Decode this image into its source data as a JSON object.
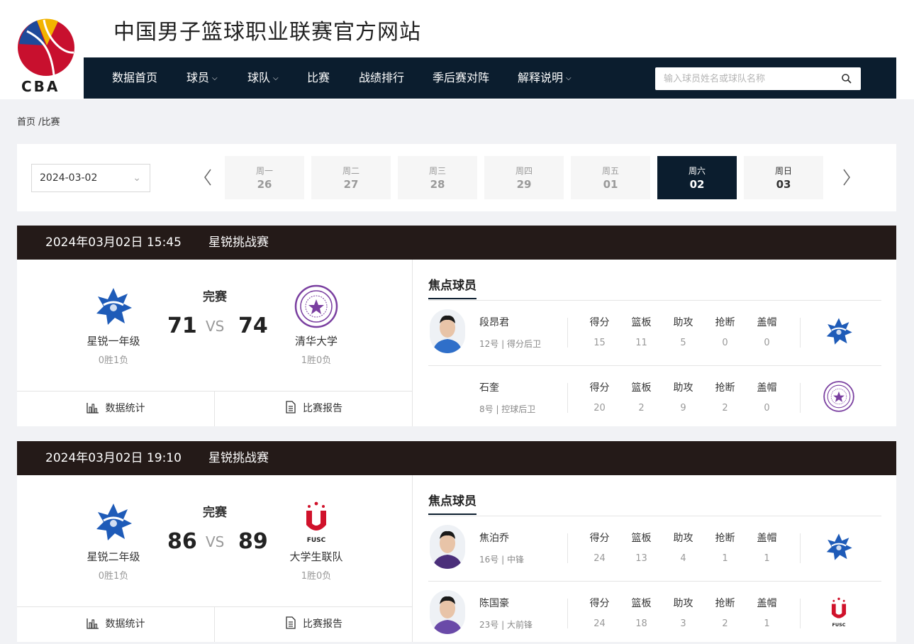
{
  "site": {
    "title": "中国男子篮球职业联赛官方网站",
    "logo_text": "CBA"
  },
  "nav": {
    "items": [
      {
        "label": "数据首页",
        "dropdown": false
      },
      {
        "label": "球员",
        "dropdown": true
      },
      {
        "label": "球队",
        "dropdown": true
      },
      {
        "label": "比赛",
        "dropdown": false
      },
      {
        "label": "战绩排行",
        "dropdown": false
      },
      {
        "label": "季后赛对阵",
        "dropdown": false
      },
      {
        "label": "解释说明",
        "dropdown": true
      }
    ],
    "search_placeholder": "输入球员姓名或球队名称"
  },
  "breadcrumb": {
    "home": "首页",
    "sep": " /",
    "current": "比赛"
  },
  "date_bar": {
    "selected_date": "2024-03-02",
    "days": [
      {
        "weekday": "周一",
        "day": "26"
      },
      {
        "weekday": "周二",
        "day": "27"
      },
      {
        "weekday": "周三",
        "day": "28"
      },
      {
        "weekday": "周四",
        "day": "29"
      },
      {
        "weekday": "周五",
        "day": "01"
      },
      {
        "weekday": "周六",
        "day": "02"
      },
      {
        "weekday": "周日",
        "day": "03"
      }
    ],
    "active_index": 5
  },
  "focus_label": "焦点球员",
  "stat_labels": [
    "得分",
    "篮板",
    "助攻",
    "抢断",
    "盖帽"
  ],
  "buttons": {
    "stats": "数据统计",
    "report": "比赛报告"
  },
  "games": [
    {
      "time": "2024年03月02日 15:45",
      "event": "星锐挑战赛",
      "status": "完赛",
      "vs": "VS",
      "home": {
        "name": "星锐一年级",
        "record": "0胜1负",
        "score": "71",
        "logo": "allstar"
      },
      "away": {
        "name": "清华大学",
        "record": "1胜0负",
        "score": "74",
        "logo": "tsinghua"
      },
      "players": [
        {
          "name": "段昂君",
          "info": "12号 | 得分后卫",
          "stats": [
            "15",
            "11",
            "5",
            "0",
            "0"
          ],
          "team_logo": "allstar",
          "has_photo": true,
          "jersey": "#2f6fc9"
        },
        {
          "name": "石奎",
          "info": "8号 | 控球后卫",
          "stats": [
            "20",
            "2",
            "9",
            "2",
            "0"
          ],
          "team_logo": "tsinghua",
          "has_photo": false,
          "jersey": ""
        }
      ]
    },
    {
      "time": "2024年03月02日 19:10",
      "event": "星锐挑战赛",
      "status": "完赛",
      "vs": "VS",
      "home": {
        "name": "星锐二年级",
        "record": "0胜1负",
        "score": "86",
        "logo": "allstar"
      },
      "away": {
        "name": "大学生联队",
        "record": "1胜0负",
        "score": "89",
        "logo": "fusc"
      },
      "players": [
        {
          "name": "焦泊乔",
          "info": "16号 | 中锋",
          "stats": [
            "24",
            "13",
            "4",
            "1",
            "1"
          ],
          "team_logo": "allstar",
          "has_photo": true,
          "jersey": "#4b2f7a"
        },
        {
          "name": "陈国豪",
          "info": "23号 | 大前锋",
          "stats": [
            "24",
            "18",
            "3",
            "2",
            "1"
          ],
          "team_logo": "fusc",
          "has_photo": true,
          "jersey": "#6a4aa8"
        }
      ]
    }
  ],
  "logo_texts": {
    "fusc": "FUSC"
  },
  "colors": {
    "nav_bg": "#0b1d2e",
    "game_header_bg": "#241a18",
    "page_bg": "#f1f2f5",
    "tsinghua_purple": "#7a3fa0",
    "fusc_red": "#d0122b",
    "allstar_blue": "#1e5bb8"
  }
}
